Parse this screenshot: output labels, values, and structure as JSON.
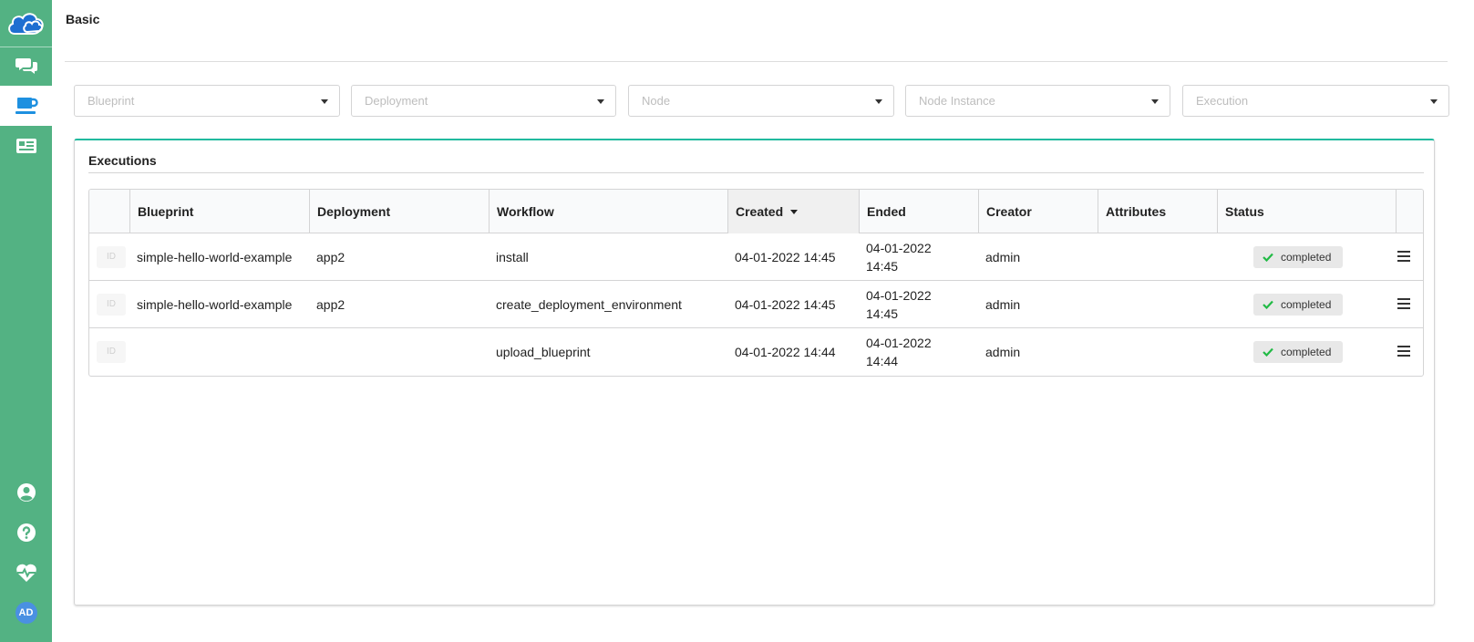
{
  "header": {
    "title": "Basic"
  },
  "sidebar": {
    "items": [
      {
        "name": "chat-icon"
      },
      {
        "name": "coffee-icon",
        "active": true
      },
      {
        "name": "newspaper-icon"
      }
    ],
    "bottom": [
      {
        "name": "user-circle-icon"
      },
      {
        "name": "help-icon"
      },
      {
        "name": "heartbeat-icon"
      }
    ],
    "avatar_initials": "AD"
  },
  "filters": {
    "blueprint": "Blueprint",
    "deployment": "Deployment",
    "node": "Node",
    "node_instance": "Node Instance",
    "execution": "Execution"
  },
  "executions": {
    "title": "Executions",
    "columns": {
      "blueprint": "Blueprint",
      "deployment": "Deployment",
      "workflow": "Workflow",
      "created": "Created",
      "ended": "Ended",
      "creator": "Creator",
      "attributes": "Attributes",
      "status": "Status"
    },
    "rows": [
      {
        "id": "ID",
        "blueprint": "simple-hello-world-example",
        "deployment": "app2",
        "workflow": "install",
        "created": "04-01-2022 14:45",
        "ended_date": "04-01-2022",
        "ended_time": "14:45",
        "creator": "admin",
        "status": "completed"
      },
      {
        "id": "ID",
        "blueprint": "simple-hello-world-example",
        "deployment": "app2",
        "workflow": "create_deployment_environment",
        "created": "04-01-2022 14:45",
        "ended_date": "04-01-2022",
        "ended_time": "14:45",
        "creator": "admin",
        "status": "completed"
      },
      {
        "id": "ID",
        "blueprint": "",
        "deployment": "",
        "workflow": "upload_blueprint",
        "created": "04-01-2022 14:44",
        "ended_date": "04-01-2022",
        "ended_time": "14:44",
        "creator": "admin",
        "status": "completed"
      }
    ]
  },
  "colors": {
    "sidebar": "#53b283",
    "accent": "#21ba9f",
    "success": "#21ba45",
    "avatar": "#4a90e2"
  }
}
